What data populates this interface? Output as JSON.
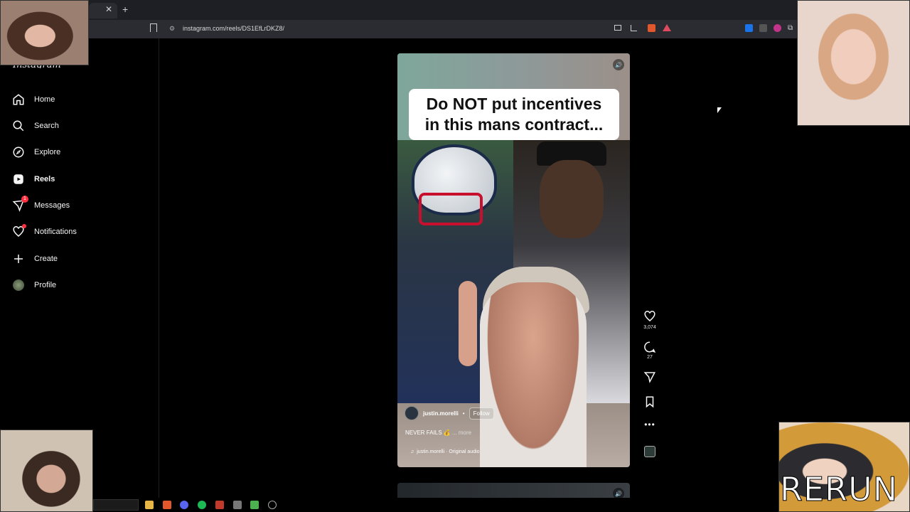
{
  "browser": {
    "url": "instagram.com/reels/DS1EfLrDKZ8/",
    "tab_close": "✕",
    "new_tab": "+"
  },
  "sidebar": {
    "logo_fragment": "Instagram",
    "items": [
      {
        "label": "Home",
        "icon": "home-icon"
      },
      {
        "label": "Search",
        "icon": "search-icon"
      },
      {
        "label": "Explore",
        "icon": "compass-icon"
      },
      {
        "label": "Reels",
        "icon": "reels-icon",
        "active": true
      },
      {
        "label": "Messages",
        "icon": "messenger-icon",
        "badge": "1"
      },
      {
        "label": "Notifications",
        "icon": "heart-icon",
        "dot": true
      },
      {
        "label": "Create",
        "icon": "plus-icon"
      },
      {
        "label": "Profile",
        "icon": "avatar-icon"
      }
    ]
  },
  "reel": {
    "overlay_title": "Do NOT put incentives\nin this mans contract...",
    "author": "justin.morelli",
    "separator": "•",
    "follow_label": "Follow",
    "caption": "NEVER FAILS 💰",
    "caption_more": "... more",
    "audio": "justin.morelli · Original audio",
    "speaker_glyph": "🔊"
  },
  "actions": {
    "likes": "3,074",
    "comments": "27"
  },
  "overlay": {
    "rerun_text": "RERUN"
  },
  "colors": {
    "accent_red": "#ff3040",
    "background": "#000000"
  }
}
